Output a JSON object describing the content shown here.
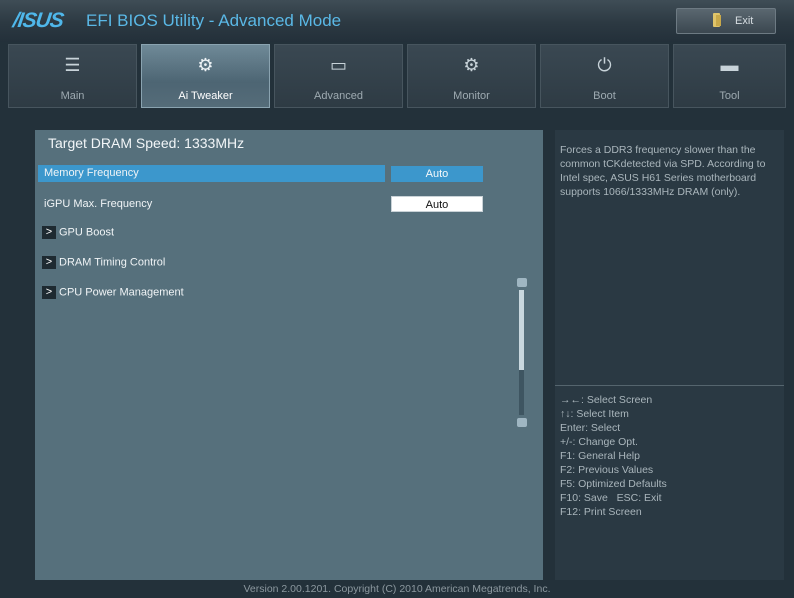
{
  "header": {
    "logo": "/ISUS",
    "title": "EFI BIOS Utility - Advanced Mode",
    "exit_label": "Exit"
  },
  "tabs": [
    {
      "label": "Main",
      "icon": "list-icon",
      "glyph": "☰",
      "active": false
    },
    {
      "label": "Ai Tweaker",
      "icon": "tweaker-icon",
      "glyph": "⚙",
      "active": true
    },
    {
      "label": "Advanced",
      "icon": "advanced-icon",
      "glyph": "▭",
      "active": false
    },
    {
      "label": "Monitor",
      "icon": "monitor-icon",
      "glyph": "⚙",
      "active": false
    },
    {
      "label": "Boot",
      "icon": "power-icon",
      "glyph": "⏻",
      "active": false
    },
    {
      "label": "Tool",
      "icon": "tool-icon",
      "glyph": "▬",
      "active": false
    }
  ],
  "main": {
    "setting_header": "Target DRAM Speed: 1333MHz",
    "memory_frequency": {
      "label": "Memory Frequency",
      "value": "Auto"
    },
    "igpu_frequency": {
      "label": "iGPU Max. Frequency",
      "value": "Auto"
    },
    "submenus": [
      {
        "arrow": ">",
        "label": "GPU Boost"
      },
      {
        "arrow": ">",
        "label": "DRAM Timing Control"
      },
      {
        "arrow": ">",
        "label": "CPU Power Management"
      }
    ]
  },
  "help": {
    "text": "Forces a DDR3 frequency slower than the common tCKdetected via SPD. According to Intel spec, ASUS H61 Series motherboard supports 1066/1333MHz DRAM (only).",
    "keys": [
      "→←: Select Screen",
      "↑↓: Select Item",
      "Enter: Select",
      "+/-: Change Opt.",
      "F1: General Help",
      "F2: Previous Values",
      "F5: Optimized Defaults",
      "F10: Save   ESC: Exit",
      "F12: Print Screen"
    ]
  },
  "footer": "Version 2.00.1201. Copyright (C) 2010 American Megatrends, Inc.",
  "colors": {
    "accent": "#3c97cc",
    "panel": "#56707c",
    "logo": "#4fb7ea"
  }
}
